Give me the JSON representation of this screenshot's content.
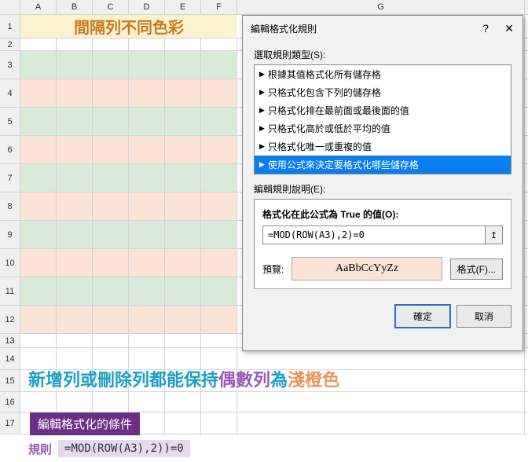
{
  "columns": [
    "A",
    "B",
    "C",
    "D",
    "E",
    "F",
    "G"
  ],
  "rows": [
    "1",
    "2",
    "3",
    "4",
    "5",
    "6",
    "7",
    "8",
    "9",
    "10",
    "11",
    "12",
    "13",
    "14",
    "15",
    "16",
    "17"
  ],
  "title": "間隔列不同色彩",
  "dialog": {
    "title": "編輯格式化規則",
    "help": "?",
    "close": "✕",
    "select_rule_type": "選取規則類型(S):",
    "rule_types": [
      "根據其值格式化所有儲存格",
      "只格式化包含下列的儲存格",
      "只格式化排在最前面或最後面的值",
      "只格式化高於或低於平均的值",
      "只格式化唯一或重複的值",
      "使用公式來決定要格式化哪些儲存格"
    ],
    "edit_rule_desc": "編輯規則說明(E):",
    "formula_label": "格式化在此公式為 True 的值(O):",
    "formula": "=MOD(ROW(A3),2)=0",
    "pick": "↥",
    "preview_label": "預覽:",
    "preview_text": "AaBbCcYyZz",
    "format_button": "格式(F)...",
    "ok": "確定",
    "cancel": "取消"
  },
  "caption": {
    "a": "新增列或刪除列都能保持",
    "b": "偶數列",
    "c": "為",
    "d": "淺橙色"
  },
  "purple_label": "編輯格式化的條件",
  "rule_lab": "規則",
  "rule_formula": "=MOD(ROW(A3),2))=0"
}
